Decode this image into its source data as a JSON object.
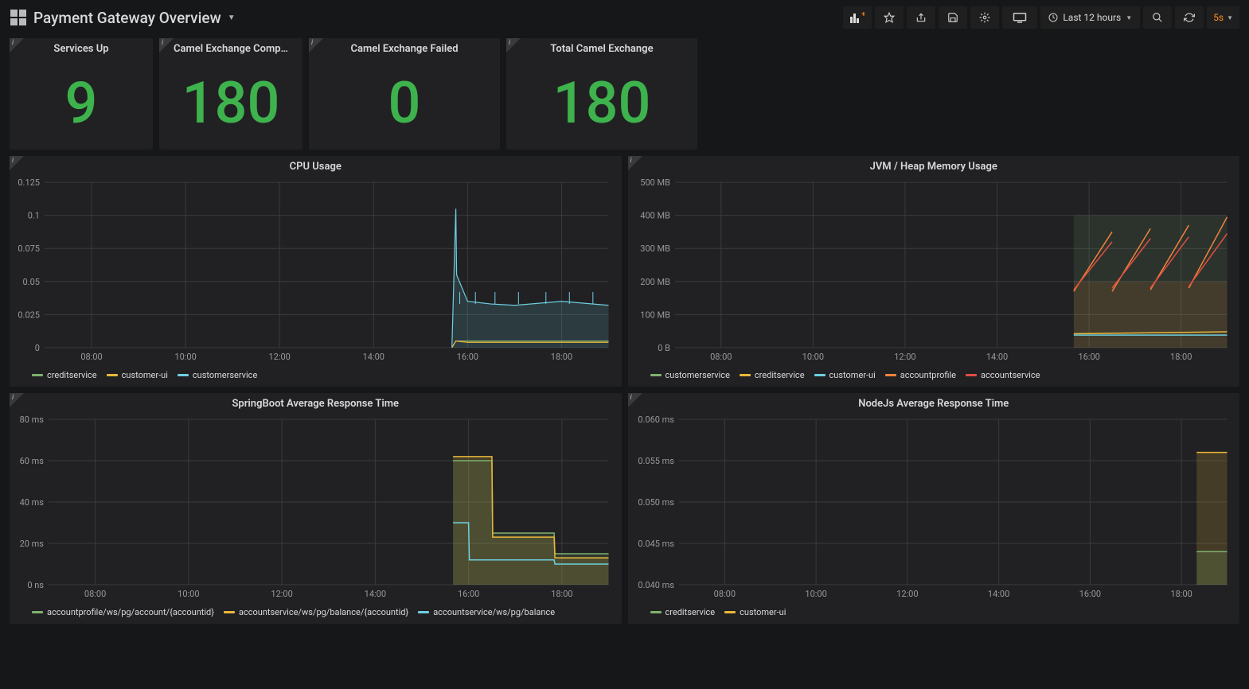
{
  "header": {
    "title": "Payment Gateway Overview",
    "time_range_label": "Last 12 hours",
    "refresh_rate": "5s"
  },
  "stats": [
    {
      "title": "Services Up",
      "value": "9"
    },
    {
      "title": "Camel Exchange Comp…",
      "value": "180"
    },
    {
      "title": "Camel Exchange Failed",
      "value": "0"
    },
    {
      "title": "Total Camel Exchange",
      "value": "180"
    }
  ],
  "charts": {
    "cpu": {
      "title": "CPU Usage",
      "legend": [
        {
          "name": "creditservice",
          "color": "#7eb26d"
        },
        {
          "name": "customer-ui",
          "color": "#eab839"
        },
        {
          "name": "customerservice",
          "color": "#6ed0e0"
        }
      ]
    },
    "jvm": {
      "title": "JVM / Heap Memory Usage",
      "legend": [
        {
          "name": "customerservice",
          "color": "#7eb26d"
        },
        {
          "name": "creditservice",
          "color": "#eab839"
        },
        {
          "name": "customer-ui",
          "color": "#6ed0e0"
        },
        {
          "name": "accountprofile",
          "color": "#ef843c"
        },
        {
          "name": "accountservice",
          "color": "#e24d42"
        }
      ]
    },
    "spring": {
      "title": "SpringBoot Average Response Time",
      "legend": [
        {
          "name": "accountprofile/ws/pg/account/{accountid}",
          "color": "#7eb26d"
        },
        {
          "name": "accountservice/ws/pg/balance/{accountid}",
          "color": "#eab839"
        },
        {
          "name": "accountservice/ws/pg/balance",
          "color": "#6ed0e0"
        }
      ]
    },
    "node": {
      "title": "NodeJs Average Response Time",
      "legend": [
        {
          "name": "creditservice",
          "color": "#7eb26d"
        },
        {
          "name": "customer-ui",
          "color": "#eab839"
        }
      ]
    }
  },
  "chart_data": [
    {
      "id": "cpu",
      "type": "line",
      "title": "CPU Usage",
      "xlabel": "",
      "ylabel": "",
      "x_ticks": [
        "08:00",
        "10:00",
        "12:00",
        "14:00",
        "16:00",
        "18:00"
      ],
      "y_ticks": [
        0,
        0.025,
        0.05,
        0.075,
        0.1,
        0.125
      ],
      "ylim": [
        0,
        0.125
      ],
      "series": [
        {
          "name": "creditservice",
          "x": [
            "15:40",
            "15:45",
            "16:00",
            "17:00",
            "18:00",
            "19:00"
          ],
          "values": [
            0.0,
            0.005,
            0.005,
            0.005,
            0.005,
            0.005
          ]
        },
        {
          "name": "customer-ui",
          "x": [
            "15:40",
            "15:45",
            "16:00",
            "17:00",
            "18:00",
            "19:00"
          ],
          "values": [
            0.0,
            0.005,
            0.004,
            0.004,
            0.004,
            0.004
          ]
        },
        {
          "name": "customerservice",
          "x": [
            "15:40",
            "15:45",
            "15:46",
            "16:00",
            "16:30",
            "17:00",
            "18:00",
            "19:00"
          ],
          "values": [
            0.0,
            0.105,
            0.055,
            0.035,
            0.033,
            0.032,
            0.035,
            0.032
          ]
        }
      ]
    },
    {
      "id": "jvm",
      "type": "line",
      "title": "JVM / Heap Memory Usage",
      "xlabel": "",
      "ylabel": "",
      "x_ticks": [
        "08:00",
        "10:00",
        "12:00",
        "14:00",
        "16:00",
        "18:00"
      ],
      "y_ticks": [
        "0 B",
        "100 MB",
        "200 MB",
        "300 MB",
        "400 MB",
        "500 MB"
      ],
      "ylim_mb": [
        0,
        500
      ],
      "series": [
        {
          "name": "customerservice",
          "oscillating": true,
          "low_mb": 170,
          "high_mb": 400,
          "x_start": "15:40"
        },
        {
          "name": "creditservice",
          "x": [
            "15:40",
            "19:00"
          ],
          "values_mb": [
            40,
            45
          ]
        },
        {
          "name": "customer-ui",
          "x": [
            "15:40",
            "19:00"
          ],
          "values_mb": [
            40,
            40
          ]
        },
        {
          "name": "accountprofile",
          "segments_mb": [
            [
              170,
              350
            ],
            [
              170,
              360
            ],
            [
              175,
              370
            ],
            [
              180,
              395
            ]
          ],
          "x_start": "15:40"
        },
        {
          "name": "accountservice",
          "segments_mb": [
            [
              175,
              320
            ],
            [
              180,
              330
            ],
            [
              180,
              335
            ],
            [
              185,
              345
            ]
          ],
          "x_start": "15:40"
        }
      ]
    },
    {
      "id": "spring",
      "type": "line",
      "title": "SpringBoot Average Response Time",
      "xlabel": "",
      "ylabel": "",
      "x_ticks": [
        "08:00",
        "10:00",
        "12:00",
        "14:00",
        "16:00",
        "18:00"
      ],
      "y_ticks": [
        "0 ns",
        "20 ms",
        "40 ms",
        "60 ms",
        "80 ms"
      ],
      "ylim_ms": [
        0,
        80
      ],
      "series": [
        {
          "name": "accountprofile/ws/pg/account/{accountid}",
          "x": [
            "15:40",
            "16:30",
            "16:31",
            "17:50",
            "17:51",
            "19:00"
          ],
          "values_ms": [
            60,
            60,
            25,
            25,
            15,
            15
          ]
        },
        {
          "name": "accountservice/ws/pg/balance/{accountid}",
          "x": [
            "15:40",
            "16:30",
            "16:31",
            "17:50",
            "17:51",
            "19:00"
          ],
          "values_ms": [
            62,
            62,
            23,
            23,
            13,
            13
          ]
        },
        {
          "name": "accountservice/ws/pg/balance",
          "x": [
            "15:40",
            "16:00",
            "16:01",
            "17:50",
            "17:51",
            "19:00"
          ],
          "values_ms": [
            30,
            30,
            12,
            12,
            10,
            10
          ]
        }
      ]
    },
    {
      "id": "node",
      "type": "line",
      "title": "NodeJs Average Response Time",
      "xlabel": "",
      "ylabel": "",
      "x_ticks": [
        "08:00",
        "10:00",
        "12:00",
        "14:00",
        "16:00",
        "18:00"
      ],
      "y_ticks": [
        "0.040 ms",
        "0.045 ms",
        "0.050 ms",
        "0.055 ms",
        "0.060 ms"
      ],
      "ylim_ms": [
        0.04,
        0.06
      ],
      "series": [
        {
          "name": "creditservice",
          "x": [
            "18:20",
            "19:00"
          ],
          "values_ms": [
            0.044,
            0.044
          ]
        },
        {
          "name": "customer-ui",
          "x": [
            "18:20",
            "19:00"
          ],
          "values_ms": [
            0.056,
            0.056
          ]
        }
      ]
    }
  ]
}
